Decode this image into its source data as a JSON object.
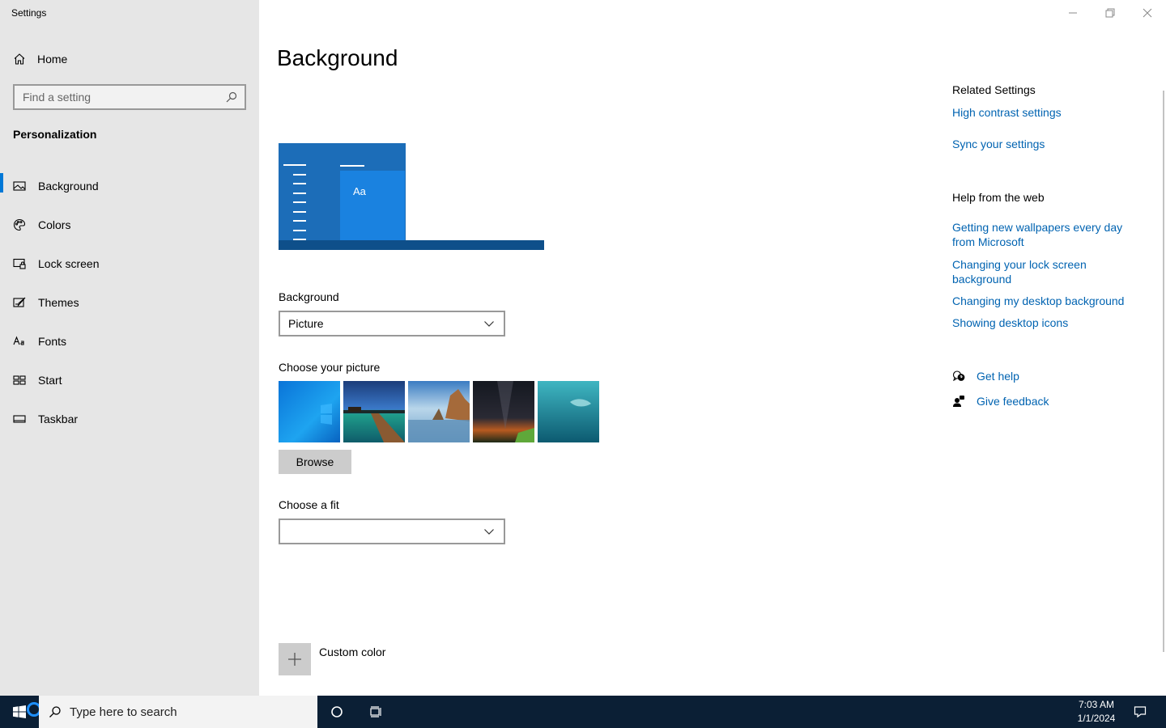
{
  "window": {
    "app_title": "Settings",
    "minimize_icon": "minimize-icon",
    "restore_icon": "restore-icon",
    "close_icon": "close-icon"
  },
  "sidebar": {
    "home_label": "Home",
    "search_placeholder": "Find a setting",
    "section_title": "Personalization",
    "items": [
      {
        "label": "Background",
        "icon": "picture-icon",
        "active": true
      },
      {
        "label": "Colors",
        "icon": "palette-icon"
      },
      {
        "label": "Lock screen",
        "icon": "lock-screen-icon"
      },
      {
        "label": "Themes",
        "icon": "themes-icon"
      },
      {
        "label": "Fonts",
        "icon": "fonts-icon"
      },
      {
        "label": "Start",
        "icon": "start-icon"
      },
      {
        "label": "Taskbar",
        "icon": "taskbar-icon"
      }
    ]
  },
  "main": {
    "title": "Background",
    "preview_text": "Aa",
    "background_label": "Background",
    "background_value": "Picture",
    "choose_picture_label": "Choose your picture",
    "browse_label": "Browse",
    "choose_fit_label": "Choose a fit",
    "choose_fit_value": "",
    "custom_color_label": "Custom color"
  },
  "related": {
    "related_title": "Related Settings",
    "related_links": [
      "High contrast settings",
      "Sync your settings"
    ],
    "help_title": "Help from the web",
    "help_links": [
      "Getting new wallpapers every day from Microsoft",
      "Changing your lock screen background",
      "Changing my desktop background",
      "Showing desktop icons"
    ],
    "get_help": "Get help",
    "give_feedback": "Give feedback"
  },
  "taskbar": {
    "search_placeholder": "Type here to search",
    "time": "7:03 AM",
    "date": "1/1/2024"
  },
  "colors": {
    "accent": "#0078d7",
    "link": "#0063b1",
    "sidebar_bg": "#e6e6e6",
    "taskbar_bg": "#0b1f35"
  }
}
